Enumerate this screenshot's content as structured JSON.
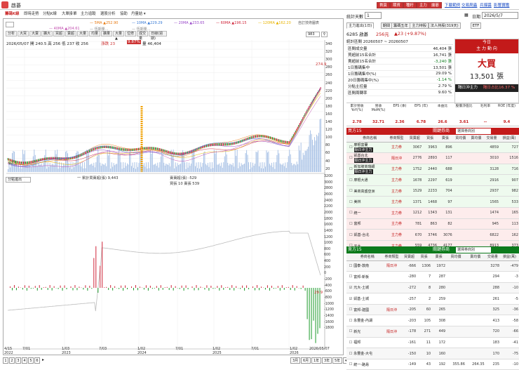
{
  "title": "啟碁",
  "top_buttons": [
    "首頁",
    "期貨",
    "種籽",
    "主力",
    "爐碁"
  ],
  "top_links": [
    "下載範例",
    "交易爬蟲",
    "兵爆醬",
    "影響寶鑑"
  ],
  "left_tabs": [
    "籌碼K線",
    "即時走勢",
    "分點K線",
    "大單掛單",
    "主力追蹤",
    "選股分析",
    "協助",
    "丹量結 ▾"
  ],
  "chart_info": {
    "date_line": "2026/05/07 開 240.5 高 256 低 237 收 256",
    "change": "漲跌 23",
    "pct": "9.87%",
    "vol": "量 46,404",
    "right_val": "274.9",
    "left_val": "92.1",
    "search_value": "983",
    "custom_label": "自訂技術圖表",
    "ma": [
      {
        "t": "5MA ▲252.90",
        "c": "#e87a12"
      },
      {
        "t": "10MA ▲229.29",
        "c": "#3a7bd5"
      },
      {
        "t": "20MA ▲233.65",
        "c": "#9a4ac9"
      },
      {
        "t": "60MA ▲196.15",
        "c": "#d0273b"
      },
      {
        "t": "120MA ▲162.20",
        "c": "#e8b400"
      }
    ],
    "ma2": [
      {
        "t": "40MA ▲204.61",
        "c": "#c24fb0"
      },
      {
        "t": "恆期量…",
        "c": "#888"
      },
      {
        "t": "恆期量…",
        "c": "#888"
      }
    ],
    "toolbar": [
      "分析",
      "大買",
      "大賣",
      "擴大",
      "買超",
      "賣超",
      "大量",
      "均量",
      "擴量",
      "大量▲",
      "位修",
      "成交量",
      "日線(週期)"
    ],
    "lower_toolbar": "分點進出",
    "lower_legend": "一 累計買賣超(張) 9,443",
    "lower_legend2": "賣賣超(張) -529",
    "lower_legend3": "買張 10  賣張 539",
    "lower_val": "29.9"
  },
  "price_axis": [
    "340",
    "320",
    "300",
    "280",
    "260",
    "240",
    "220",
    "200",
    "180",
    "160",
    "140",
    "120",
    "100",
    "80",
    "60",
    "40",
    "20"
  ],
  "lower_axis": [
    "3200",
    "3000",
    "2800",
    "2600",
    "2400",
    "2200",
    "2000",
    "1800",
    "1600",
    "1400",
    "1200",
    "1000",
    "800",
    "600",
    "400",
    "200",
    "0",
    "-200",
    "-400",
    "-600",
    "-800",
    "-1000",
    "-1200",
    "-1400",
    "-1600",
    "-1800"
  ],
  "x_axis": [
    {
      "t": "4/15",
      "s": "2022"
    },
    {
      "t": "7/01",
      "s": ""
    },
    {
      "t": "1/03",
      "s": "2023"
    },
    {
      "t": "7/03",
      "s": ""
    },
    {
      "t": "1/02",
      "s": "2024"
    },
    {
      "t": "7/01",
      "s": ""
    },
    {
      "t": "1/02",
      "s": "2025"
    },
    {
      "t": "7/01",
      "s": ""
    },
    {
      "t": "1/02",
      "s": "2026"
    },
    {
      "t": "2026/05/07",
      "s": ""
    }
  ],
  "pages": [
    "1",
    "2",
    "3",
    "4",
    "5",
    "6"
  ],
  "periods": [
    "3月",
    "6月",
    "1年",
    "3年",
    "5年",
    "▾"
  ],
  "right": {
    "period_label": "統計天數",
    "period_value": "1",
    "date_label": "日期",
    "date_value": "2026/5/7",
    "tabs": [
      "主力進出(1日)",
      "期間",
      "籌碼五年",
      "主力持股",
      "法人持股(319天)",
      "ETF"
    ],
    "stock": "6285 啟碁",
    "price": "256元",
    "chg": "▲23 (+9.87%)",
    "range": "統計區間 20260507 ~ 20260507",
    "stats": [
      {
        "k": "區間成交量",
        "v": "46,404 張"
      },
      {
        "k": "買超前15名合計",
        "v": "16,741 張"
      },
      {
        "k": "賣超前15名合計",
        "v": "-3,240 張"
      },
      {
        "k": "1日籌碼集中",
        "v": "13,501 張"
      },
      {
        "k": "1日籌碼集中(%)",
        "v": "29.09 %"
      },
      {
        "k": "20日籌碼集中(%)",
        "v": "-1.14 %"
      },
      {
        "k": "分點主控量",
        "v": "2.79 %"
      },
      {
        "k": "區間周轉率",
        "v": "9.60 %"
      }
    ],
    "today_label": "今日",
    "today_sub": "主 力 動 向",
    "today_big": "大買",
    "today_amt": "13,501 張",
    "today_note": "隔日沖主力",
    "today_note2": "隔日占比16.37 %",
    "fund_heads": [
      "累計營收 YoY(%)",
      "營收 MoM(%)",
      "EPS (季)",
      "EPS (年)",
      "本益比",
      "股價淨值比",
      "毛利率",
      "ROE (年度)"
    ],
    "fund_vals": [
      "2.78",
      "32.71",
      "2.36",
      "6.78",
      "26.6",
      "3.61",
      "--",
      "9.4"
    ],
    "buy_head": "買方15",
    "sell_head": "賣方15",
    "select_label": "關鍵券商",
    "filter": "選擇券商別",
    "cols": [
      "",
      "券商名稱",
      "券商類型",
      "買賣超",
      "買張",
      "賣張",
      "買均價",
      "賣均價",
      "交易量",
      "損益(萬)"
    ],
    "buyers": [
      {
        "n": "摩根富蘭",
        "tag": "隔日沖主力",
        "t": "主力券",
        "v": "3067",
        "b": "3963",
        "s": "896",
        "tv": "4859",
        "p": "727",
        "g": true
      },
      {
        "n": "凱基台北",
        "tag": "隔日沖主力",
        "t": "隔日沖",
        "v": "2776",
        "b": "2893",
        "s": "117",
        "tv": "3010",
        "p": "1516",
        "g": false
      },
      {
        "n": "新加坡商瑞銀",
        "tag": "隔日沖主力",
        "t": "主力券",
        "v": "1752",
        "b": "2440",
        "s": "688",
        "tv": "3128",
        "p": "716",
        "g": true
      },
      {
        "n": "摩根大通",
        "tag": "",
        "t": "主力券",
        "v": "1678",
        "b": "2297",
        "s": "619",
        "tv": "2916",
        "p": "907",
        "g": true
      },
      {
        "n": "美商高盛亞洲",
        "tag": "",
        "t": "主力券",
        "v": "1529",
        "b": "2233",
        "s": "704",
        "tv": "2937",
        "p": "982",
        "g": true
      },
      {
        "n": "美林",
        "tag": "",
        "t": "主力券",
        "v": "1371",
        "b": "1468",
        "s": "97",
        "tv": "1565",
        "p": "533",
        "g": true
      },
      {
        "n": "統一",
        "tag": "",
        "t": "主力券",
        "v": "1212",
        "b": "1343",
        "s": "131",
        "tv": "1474",
        "p": "165",
        "g": false
      },
      {
        "n": "富邦",
        "tag": "",
        "t": "主力券",
        "v": "781",
        "b": "863",
        "s": "82",
        "tv": "945",
        "p": "113",
        "g": false
      },
      {
        "n": "凱基-台北",
        "tag": "",
        "t": "主力券",
        "v": "670",
        "b": "3746",
        "s": "3076",
        "tv": "6822",
        "p": "162",
        "g": false
      },
      {
        "n": "元大",
        "tag": "",
        "t": "主力券",
        "v": "559",
        "b": "4736",
        "s": "4177",
        "tv": "8913",
        "p": "373",
        "g": false
      }
    ],
    "sellers": [
      {
        "n": "國泰-敦南",
        "t": "隔日沖",
        "v": "-666",
        "b": "1306",
        "s": "1972",
        "tv": "3278",
        "p": "-479"
      },
      {
        "n": "富邦-新板",
        "t": "",
        "v": "-280",
        "b": "7",
        "s": "287",
        "tv": "294",
        "p": "-3"
      },
      {
        "n": "元大-土城",
        "t": "",
        "v": "-272",
        "b": "8",
        "s": "280",
        "tv": "288",
        "p": "-10"
      },
      {
        "n": "凱基-土城",
        "t": "",
        "v": "-257",
        "b": "2",
        "s": "259",
        "tv": "261",
        "p": "-5"
      },
      {
        "n": "富邦-建國",
        "t": "隔日沖",
        "v": "-205",
        "b": "60",
        "s": "265",
        "tv": "325",
        "p": "-36"
      },
      {
        "n": "永豐金-內湖",
        "t": "",
        "v": "-203",
        "b": "105",
        "s": "308",
        "tv": "413",
        "p": "-58"
      },
      {
        "n": "新光",
        "t": "隔日沖",
        "v": "-178",
        "b": "271",
        "s": "449",
        "tv": "720",
        "p": "-66"
      },
      {
        "n": "福邦",
        "t": "",
        "v": "-161",
        "b": "11",
        "s": "172",
        "tv": "183",
        "p": "-41"
      },
      {
        "n": "永豐金-大屯",
        "t": "",
        "v": "-150",
        "b": "10",
        "s": "160",
        "tv": "170",
        "p": "-75"
      },
      {
        "n": "統一-路易",
        "t": "",
        "v": "-149",
        "b": "43",
        "s": "192",
        "tv": "235",
        "p": "-10"
      }
    ],
    "seller_last_avg": [
      "355.86",
      "264.35"
    ]
  }
}
